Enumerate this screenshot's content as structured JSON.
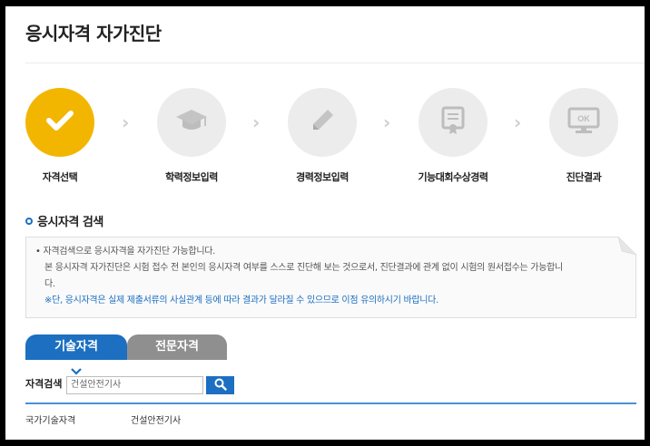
{
  "page": {
    "title": "응시자격 자가진단"
  },
  "steps": [
    {
      "label": "자격선택",
      "icon": "check-icon",
      "active": true
    },
    {
      "label": "학력정보입력",
      "icon": "graduation-cap-icon",
      "active": false
    },
    {
      "label": "경력정보입력",
      "icon": "pencil-icon",
      "active": false
    },
    {
      "label": "기능대회수상경력",
      "icon": "certificate-icon",
      "active": false
    },
    {
      "label": "진단결과",
      "icon": "monitor-ok-icon",
      "active": false,
      "icon_text": "OK"
    }
  ],
  "section": {
    "title": "응시자격 검색",
    "info_line1": "자격검색으로 응시자격을 자가진단 가능합니다.",
    "info_line2": "본 응시자격 자가진단은 시험 접수 전 본인의 응시자격 여부를 스스로 진단해 보는 것으로서, 진단결과에 관계 없이 시험의 원서접수는 가능합니",
    "info_line3": "다.",
    "info_note": "※단, 응시자격은 실제 제출서류의 사실관계 등에 따라 결과가 달라질 수 있으므로 이점 유의하시기 바랍니다."
  },
  "tabs": [
    {
      "label": "기술자격",
      "active": true
    },
    {
      "label": "전문자격",
      "active": false
    }
  ],
  "search": {
    "label": "자격검색",
    "value": "건설안전기사"
  },
  "results": [
    {
      "category": "국가기술자격",
      "name": "건설안전기사"
    }
  ],
  "colors": {
    "accent_blue": "#1c6fc1",
    "active_step": "#f2b600",
    "inactive_step": "#ececec",
    "inactive_tab": "#8f8f8f"
  }
}
